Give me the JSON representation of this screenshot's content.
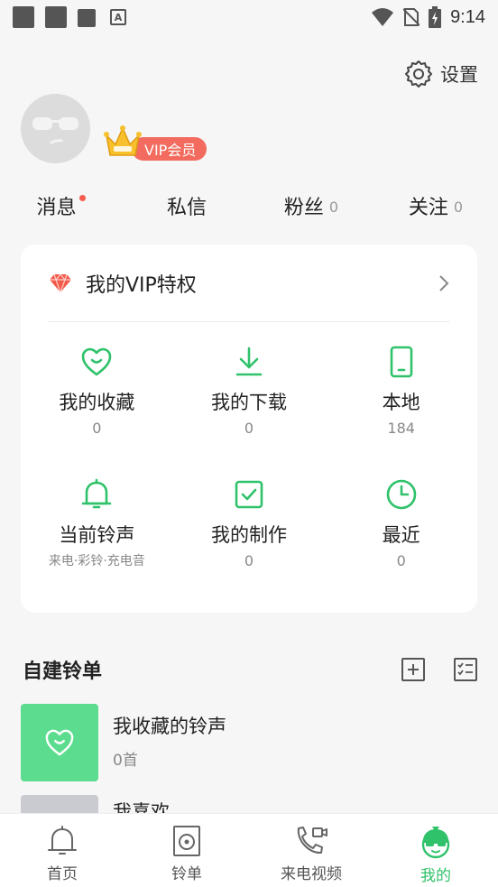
{
  "status_bar": {
    "time": "9:14"
  },
  "header": {
    "settings_label": "设置"
  },
  "profile": {
    "vip_label": "VIP会员"
  },
  "social": [
    {
      "label": "消息",
      "count": ""
    },
    {
      "label": "私信",
      "count": ""
    },
    {
      "label": "粉丝",
      "count": "0"
    },
    {
      "label": "关注",
      "count": "0"
    }
  ],
  "vip_card": {
    "title": "我的VIP特权"
  },
  "grid": [
    {
      "label": "我的收藏",
      "sub": "0",
      "icon": "heart-icon"
    },
    {
      "label": "我的下载",
      "sub": "0",
      "icon": "download-icon"
    },
    {
      "label": "本地",
      "sub": "184",
      "icon": "phone-icon"
    },
    {
      "label": "当前铃声",
      "sub": "来电·彩铃·充电音",
      "icon": "bell-icon"
    },
    {
      "label": "我的制作",
      "sub": "0",
      "icon": "check-square-icon"
    },
    {
      "label": "最近",
      "sub": "0",
      "icon": "clock-icon"
    }
  ],
  "playlists": {
    "title": "自建铃单",
    "items": [
      {
        "name": "我收藏的铃声",
        "count": "0首"
      },
      {
        "name": "我喜欢",
        "count": ""
      }
    ]
  },
  "bottom_nav": [
    {
      "label": "首页",
      "icon": "bell-icon"
    },
    {
      "label": "铃单",
      "icon": "speaker-icon"
    },
    {
      "label": "来电视频",
      "icon": "video-call-icon"
    },
    {
      "label": "我的",
      "icon": "avatar-icon",
      "active": true
    }
  ],
  "colors": {
    "accent": "#2fc26a",
    "vip": "#f26b5e",
    "cover": "#5bdc8e"
  }
}
